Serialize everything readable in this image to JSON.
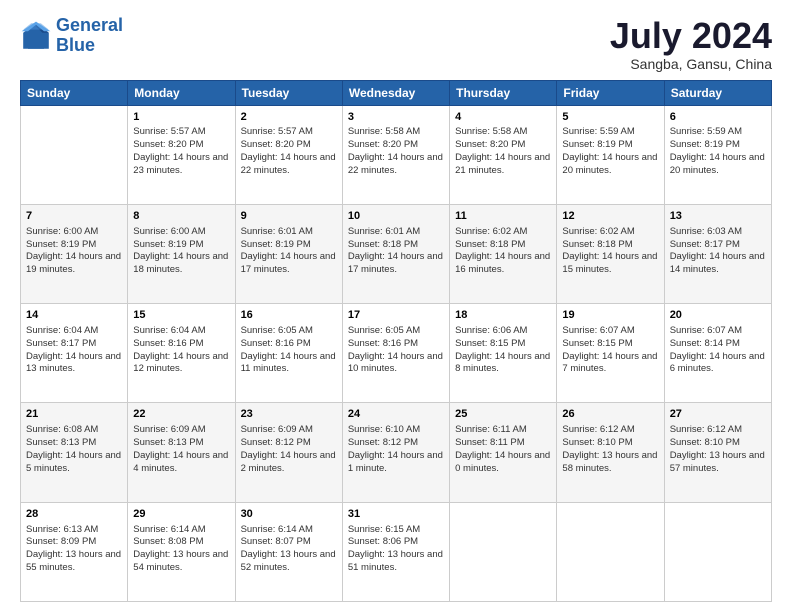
{
  "header": {
    "logo_general": "General",
    "logo_blue": "Blue",
    "month": "July 2024",
    "location": "Sangba, Gansu, China"
  },
  "weekdays": [
    "Sunday",
    "Monday",
    "Tuesday",
    "Wednesday",
    "Thursday",
    "Friday",
    "Saturday"
  ],
  "weeks": [
    [
      {
        "day": "",
        "sunrise": "",
        "sunset": "",
        "daylight": ""
      },
      {
        "day": "1",
        "sunrise": "Sunrise: 5:57 AM",
        "sunset": "Sunset: 8:20 PM",
        "daylight": "Daylight: 14 hours and 23 minutes."
      },
      {
        "day": "2",
        "sunrise": "Sunrise: 5:57 AM",
        "sunset": "Sunset: 8:20 PM",
        "daylight": "Daylight: 14 hours and 22 minutes."
      },
      {
        "day": "3",
        "sunrise": "Sunrise: 5:58 AM",
        "sunset": "Sunset: 8:20 PM",
        "daylight": "Daylight: 14 hours and 22 minutes."
      },
      {
        "day": "4",
        "sunrise": "Sunrise: 5:58 AM",
        "sunset": "Sunset: 8:20 PM",
        "daylight": "Daylight: 14 hours and 21 minutes."
      },
      {
        "day": "5",
        "sunrise": "Sunrise: 5:59 AM",
        "sunset": "Sunset: 8:19 PM",
        "daylight": "Daylight: 14 hours and 20 minutes."
      },
      {
        "day": "6",
        "sunrise": "Sunrise: 5:59 AM",
        "sunset": "Sunset: 8:19 PM",
        "daylight": "Daylight: 14 hours and 20 minutes."
      }
    ],
    [
      {
        "day": "7",
        "sunrise": "Sunrise: 6:00 AM",
        "sunset": "Sunset: 8:19 PM",
        "daylight": "Daylight: 14 hours and 19 minutes."
      },
      {
        "day": "8",
        "sunrise": "Sunrise: 6:00 AM",
        "sunset": "Sunset: 8:19 PM",
        "daylight": "Daylight: 14 hours and 18 minutes."
      },
      {
        "day": "9",
        "sunrise": "Sunrise: 6:01 AM",
        "sunset": "Sunset: 8:19 PM",
        "daylight": "Daylight: 14 hours and 17 minutes."
      },
      {
        "day": "10",
        "sunrise": "Sunrise: 6:01 AM",
        "sunset": "Sunset: 8:18 PM",
        "daylight": "Daylight: 14 hours and 17 minutes."
      },
      {
        "day": "11",
        "sunrise": "Sunrise: 6:02 AM",
        "sunset": "Sunset: 8:18 PM",
        "daylight": "Daylight: 14 hours and 16 minutes."
      },
      {
        "day": "12",
        "sunrise": "Sunrise: 6:02 AM",
        "sunset": "Sunset: 8:18 PM",
        "daylight": "Daylight: 14 hours and 15 minutes."
      },
      {
        "day": "13",
        "sunrise": "Sunrise: 6:03 AM",
        "sunset": "Sunset: 8:17 PM",
        "daylight": "Daylight: 14 hours and 14 minutes."
      }
    ],
    [
      {
        "day": "14",
        "sunrise": "Sunrise: 6:04 AM",
        "sunset": "Sunset: 8:17 PM",
        "daylight": "Daylight: 14 hours and 13 minutes."
      },
      {
        "day": "15",
        "sunrise": "Sunrise: 6:04 AM",
        "sunset": "Sunset: 8:16 PM",
        "daylight": "Daylight: 14 hours and 12 minutes."
      },
      {
        "day": "16",
        "sunrise": "Sunrise: 6:05 AM",
        "sunset": "Sunset: 8:16 PM",
        "daylight": "Daylight: 14 hours and 11 minutes."
      },
      {
        "day": "17",
        "sunrise": "Sunrise: 6:05 AM",
        "sunset": "Sunset: 8:16 PM",
        "daylight": "Daylight: 14 hours and 10 minutes."
      },
      {
        "day": "18",
        "sunrise": "Sunrise: 6:06 AM",
        "sunset": "Sunset: 8:15 PM",
        "daylight": "Daylight: 14 hours and 8 minutes."
      },
      {
        "day": "19",
        "sunrise": "Sunrise: 6:07 AM",
        "sunset": "Sunset: 8:15 PM",
        "daylight": "Daylight: 14 hours and 7 minutes."
      },
      {
        "day": "20",
        "sunrise": "Sunrise: 6:07 AM",
        "sunset": "Sunset: 8:14 PM",
        "daylight": "Daylight: 14 hours and 6 minutes."
      }
    ],
    [
      {
        "day": "21",
        "sunrise": "Sunrise: 6:08 AM",
        "sunset": "Sunset: 8:13 PM",
        "daylight": "Daylight: 14 hours and 5 minutes."
      },
      {
        "day": "22",
        "sunrise": "Sunrise: 6:09 AM",
        "sunset": "Sunset: 8:13 PM",
        "daylight": "Daylight: 14 hours and 4 minutes."
      },
      {
        "day": "23",
        "sunrise": "Sunrise: 6:09 AM",
        "sunset": "Sunset: 8:12 PM",
        "daylight": "Daylight: 14 hours and 2 minutes."
      },
      {
        "day": "24",
        "sunrise": "Sunrise: 6:10 AM",
        "sunset": "Sunset: 8:12 PM",
        "daylight": "Daylight: 14 hours and 1 minute."
      },
      {
        "day": "25",
        "sunrise": "Sunrise: 6:11 AM",
        "sunset": "Sunset: 8:11 PM",
        "daylight": "Daylight: 14 hours and 0 minutes."
      },
      {
        "day": "26",
        "sunrise": "Sunrise: 6:12 AM",
        "sunset": "Sunset: 8:10 PM",
        "daylight": "Daylight: 13 hours and 58 minutes."
      },
      {
        "day": "27",
        "sunrise": "Sunrise: 6:12 AM",
        "sunset": "Sunset: 8:10 PM",
        "daylight": "Daylight: 13 hours and 57 minutes."
      }
    ],
    [
      {
        "day": "28",
        "sunrise": "Sunrise: 6:13 AM",
        "sunset": "Sunset: 8:09 PM",
        "daylight": "Daylight: 13 hours and 55 minutes."
      },
      {
        "day": "29",
        "sunrise": "Sunrise: 6:14 AM",
        "sunset": "Sunset: 8:08 PM",
        "daylight": "Daylight: 13 hours and 54 minutes."
      },
      {
        "day": "30",
        "sunrise": "Sunrise: 6:14 AM",
        "sunset": "Sunset: 8:07 PM",
        "daylight": "Daylight: 13 hours and 52 minutes."
      },
      {
        "day": "31",
        "sunrise": "Sunrise: 6:15 AM",
        "sunset": "Sunset: 8:06 PM",
        "daylight": "Daylight: 13 hours and 51 minutes."
      },
      {
        "day": "",
        "sunrise": "",
        "sunset": "",
        "daylight": ""
      },
      {
        "day": "",
        "sunrise": "",
        "sunset": "",
        "daylight": ""
      },
      {
        "day": "",
        "sunrise": "",
        "sunset": "",
        "daylight": ""
      }
    ]
  ]
}
